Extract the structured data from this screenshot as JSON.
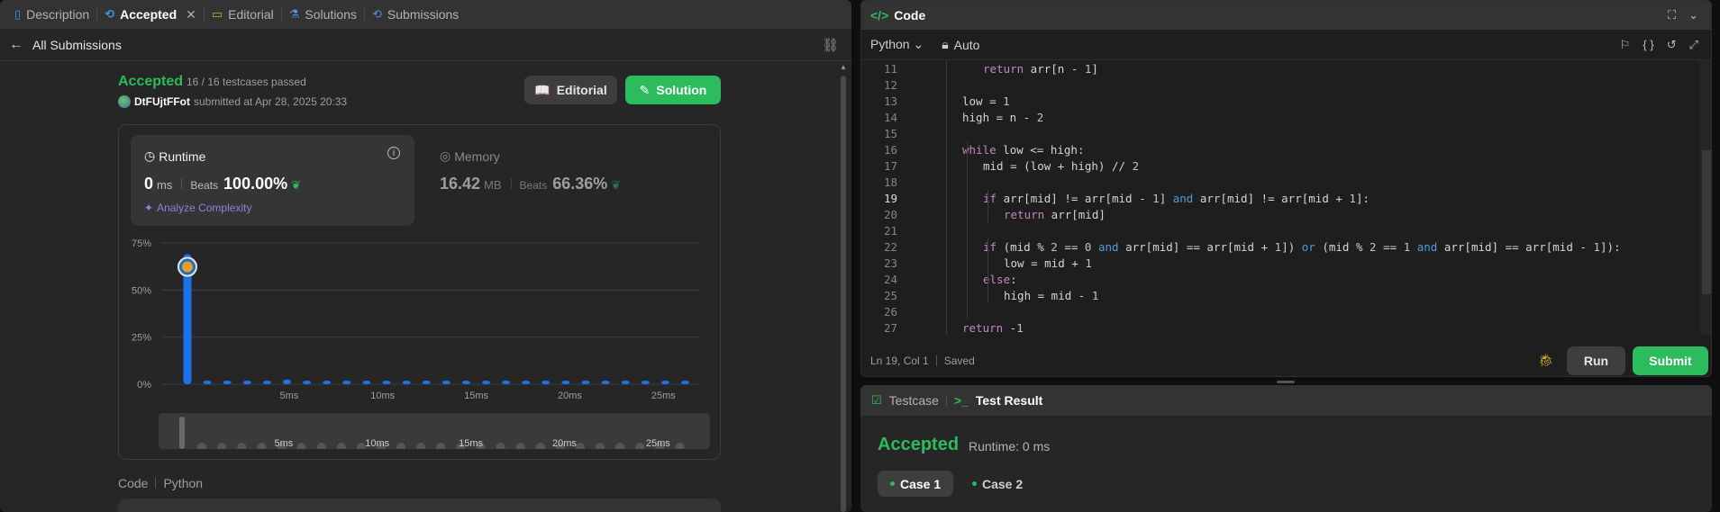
{
  "left_panel": {
    "tabs": [
      {
        "label": "Description",
        "icon": "description-icon"
      },
      {
        "label": "Accepted",
        "icon": "history-icon"
      },
      {
        "label": "Editorial",
        "icon": "book-icon"
      },
      {
        "label": "Solutions",
        "icon": "flask-icon"
      },
      {
        "label": "Submissions",
        "icon": "history-icon"
      }
    ],
    "back_label": "All Submissions",
    "status": "Accepted",
    "testcases": "16 / 16 testcases passed",
    "username": "DtFUjtFFot",
    "submitted_text": "submitted at Apr 28, 2025 20:33",
    "editorial_button": "Editorial",
    "solution_button": "Solution",
    "runtime": {
      "label": "Runtime",
      "value": "0",
      "unit": "ms",
      "beats_label": "Beats",
      "beats_value": "100.00%",
      "analyze": "Analyze Complexity"
    },
    "memory": {
      "label": "Memory",
      "value": "16.42",
      "unit": "MB",
      "beats_label": "Beats",
      "beats_value": "66.36%"
    },
    "code_label": "Code",
    "code_lang": "Python"
  },
  "chart_data": {
    "type": "bar",
    "y_ticks": [
      "75%",
      "50%",
      "25%",
      "0%"
    ],
    "ylim": [
      0,
      75
    ],
    "x_ticks": [
      "5ms",
      "10ms",
      "15ms",
      "20ms",
      "25ms"
    ],
    "values": [
      69,
      0.8,
      0.8,
      1.5,
      0.8,
      2.5,
      0.8,
      0.8,
      0.8,
      0.8,
      0.8,
      0.8,
      0.8,
      0.8,
      0.8,
      0.8,
      0.8,
      0.8,
      0.8,
      0.8,
      0.8,
      0.8,
      0.8,
      0.8,
      0.8,
      0.8
    ],
    "highlight_index": 0,
    "bar_color": "#1a73e8",
    "range_ticks": [
      "5ms",
      "10ms",
      "15ms",
      "20ms",
      "25ms"
    ]
  },
  "editor": {
    "title": "Code",
    "language": "Python",
    "mode": "Auto",
    "lines": [
      {
        "n": "11",
        "indent": 3,
        "html": "<span class='kw'>return</span> arr[n - <span class='num'>1</span>]"
      },
      {
        "n": "12",
        "indent": 0,
        "html": ""
      },
      {
        "n": "13",
        "indent": 2,
        "html": "low = <span class='num'>1</span>"
      },
      {
        "n": "14",
        "indent": 2,
        "html": "high = n - <span class='num'>2</span>"
      },
      {
        "n": "15",
        "indent": 0,
        "html": ""
      },
      {
        "n": "16",
        "indent": 2,
        "html": "<span class='kw'>while</span> low &lt;= high:"
      },
      {
        "n": "17",
        "indent": 3,
        "html": "mid = (low + high) // <span class='num'>2</span>"
      },
      {
        "n": "18",
        "indent": 0,
        "html": ""
      },
      {
        "n": "19",
        "indent": 3,
        "html": "<span class='kw'>if</span> arr[mid] != arr[mid - <span class='num'>1</span>] <span class='kwb'>and</span> arr[mid] != arr[mid + <span class='num'>1</span>]:"
      },
      {
        "n": "20",
        "indent": 4,
        "html": "<span class='kw'>return</span> arr[mid]"
      },
      {
        "n": "21",
        "indent": 0,
        "html": ""
      },
      {
        "n": "22",
        "indent": 3,
        "html": "<span class='kw'>if</span> (mid % <span class='num'>2</span> == <span class='num'>0</span> <span class='kwb'>and</span> arr[mid] == arr[mid + <span class='num'>1</span>]) <span class='kwb'>or</span> (mid % <span class='num'>2</span> == <span class='num'>1</span> <span class='kwb'>and</span> arr[mid] == arr[mid - <span class='num'>1</span>]):"
      },
      {
        "n": "23",
        "indent": 4,
        "html": "low = mid + <span class='num'>1</span>"
      },
      {
        "n": "24",
        "indent": 3,
        "html": "<span class='kw'>else</span>:"
      },
      {
        "n": "25",
        "indent": 4,
        "html": "high = mid - <span class='num'>1</span>"
      },
      {
        "n": "26",
        "indent": 0,
        "html": ""
      },
      {
        "n": "27",
        "indent": 2,
        "html": "<span class='kw'>return</span> -<span class='num'>1</span>"
      }
    ],
    "current_line": "19",
    "status_position": "Ln 19, Col 1",
    "status_saved": "Saved",
    "run_button": "Run",
    "submit_button": "Submit"
  },
  "result": {
    "tab_testcase": "Testcase",
    "tab_result": "Test Result",
    "status": "Accepted",
    "runtime": "Runtime: 0 ms",
    "cases": [
      "Case 1",
      "Case 2"
    ]
  }
}
